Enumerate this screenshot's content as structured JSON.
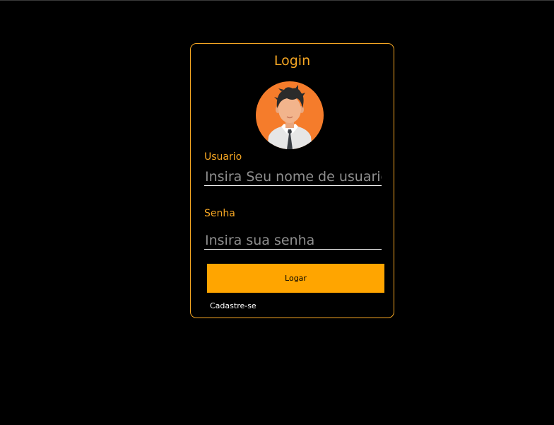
{
  "login_card": {
    "title": "Login",
    "avatar_icon": "user-avatar-icon",
    "username": {
      "label": "Usuario",
      "placeholder": "Insira Seu nome de usuario",
      "value": ""
    },
    "password": {
      "label": "Senha",
      "placeholder": "Insira sua senha",
      "value": ""
    },
    "submit_label": "Logar",
    "signup_link": "Cadastre-se"
  },
  "colors": {
    "background": "#000000",
    "accent": "#f5a623",
    "button": "#ffa500",
    "avatar_bg": "#f57c2b"
  }
}
